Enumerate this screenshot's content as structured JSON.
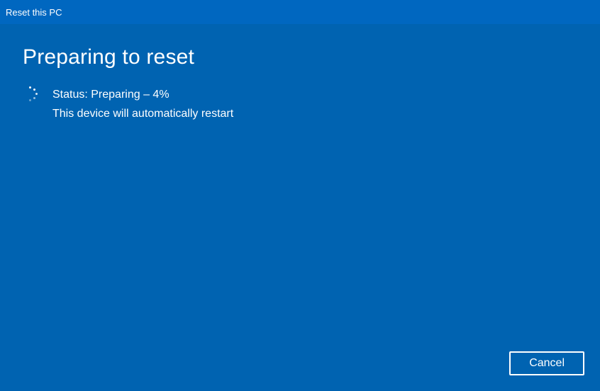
{
  "window": {
    "title": "Reset this PC"
  },
  "main": {
    "heading": "Preparing to reset",
    "status_line": "Status: Preparing – 4%",
    "restart_notice": "This device will automatically restart",
    "progress_percent": 4
  },
  "footer": {
    "cancel_label": "Cancel"
  },
  "colors": {
    "background": "#0063B1",
    "titlebar": "#0067C0",
    "text": "#FFFFFF"
  }
}
